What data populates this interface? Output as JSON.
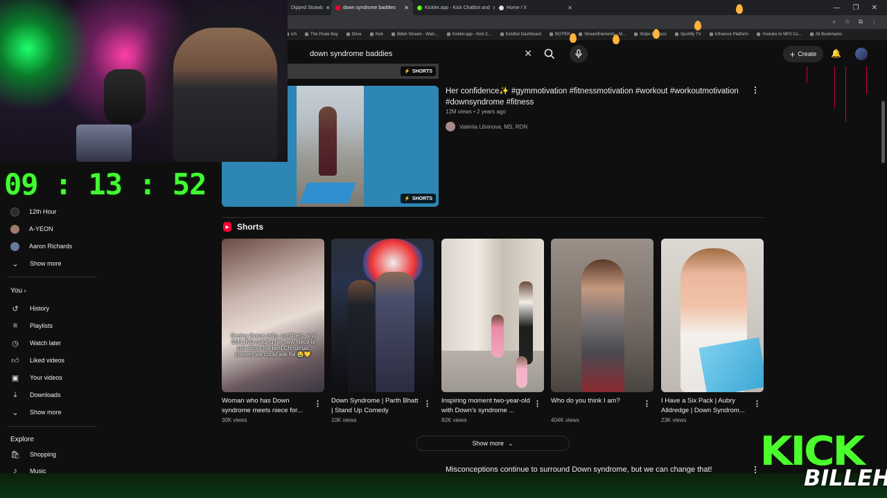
{
  "browser": {
    "tabs": [
      {
        "label": "Dipped Strawb",
        "active": false
      },
      {
        "label": "down syndrome baddies",
        "active": true
      },
      {
        "label": "Kicklet.app - Kick Chatbot and",
        "active": false
      },
      {
        "label": "Home / X",
        "active": false
      }
    ],
    "bookmarks": [
      "tch",
      "The Pirate Bay",
      "Drive",
      "Kick",
      "Billeh Stream - Watc...",
      "Kicklet.app - Kick C...",
      "KickBot Dashboard",
      "BOTRIX",
      "StreamElements - M...",
      "Stripe Express",
      "Sportify TV",
      "Influence Platform",
      "Youtube to MP3 Co...",
      "All Bookmarks"
    ]
  },
  "header": {
    "search_query": "down syndrome baddies",
    "create_label": "Create"
  },
  "overlay": {
    "timer": "09 : 13 : 52",
    "kick_logo": "KICK",
    "kick_user": "BILLEH"
  },
  "sidebar": {
    "subscriptions": [
      {
        "label": "12th Hour",
        "color": "#2b2b2b"
      },
      {
        "label": "A-YEON",
        "color": "#a07a6a"
      },
      {
        "label": "Aaron Richards",
        "color": "#6a7a9a"
      }
    ],
    "subs_show_more": "Show more",
    "you_heading": "You",
    "you_items": [
      {
        "label": "History",
        "icon": "history-icon"
      },
      {
        "label": "Playlists",
        "icon": "playlists-icon"
      },
      {
        "label": "Watch later",
        "icon": "watch-later-icon"
      },
      {
        "label": "Liked videos",
        "icon": "liked-icon"
      },
      {
        "label": "Your videos",
        "icon": "your-videos-icon"
      },
      {
        "label": "Downloads",
        "icon": "downloads-icon"
      }
    ],
    "you_show_more": "Show more",
    "explore_heading": "Explore",
    "explore_items": [
      {
        "label": "Shopping",
        "icon": "shopping-icon"
      },
      {
        "label": "Music",
        "icon": "music-icon"
      }
    ]
  },
  "results": {
    "shorts_badge": "SHORTS",
    "video": {
      "title": "Her confidence✨ #gymmotivation #fitnessmotivation #workout #workoutmotivation #downsyndrome #fitness",
      "meta": "12M views • 2 years ago",
      "channel": "Valeriia Litvinova, MS, RDN"
    },
    "shorts_heading": "Shorts",
    "shorts": [
      {
        "title": "Woman who has Down syndrome meets niece for...",
        "views": "30K views",
        "caption": "Seeing Grace calm, confident, and SMILING holding her new niece is just about the best Christmas present we could ask for 😭💛"
      },
      {
        "title": "Down Syndrome | Parth Bhatt | Stand Up Comedy",
        "views": "10K views",
        "caption": ""
      },
      {
        "title": "Inspiring moment two-year-old with Down's syndrome ...",
        "views": "82K views",
        "caption": ""
      },
      {
        "title": "Who do you think I am?",
        "views": "404K views",
        "caption": ""
      },
      {
        "title": "I Have a Six Pack | Aubry Alldredge | Down Syndrom...",
        "views": "23K views",
        "caption": ""
      }
    ],
    "show_more": "Show more",
    "next_title": "Misconceptions continue to surround Down syndrome, but we can change that!"
  }
}
